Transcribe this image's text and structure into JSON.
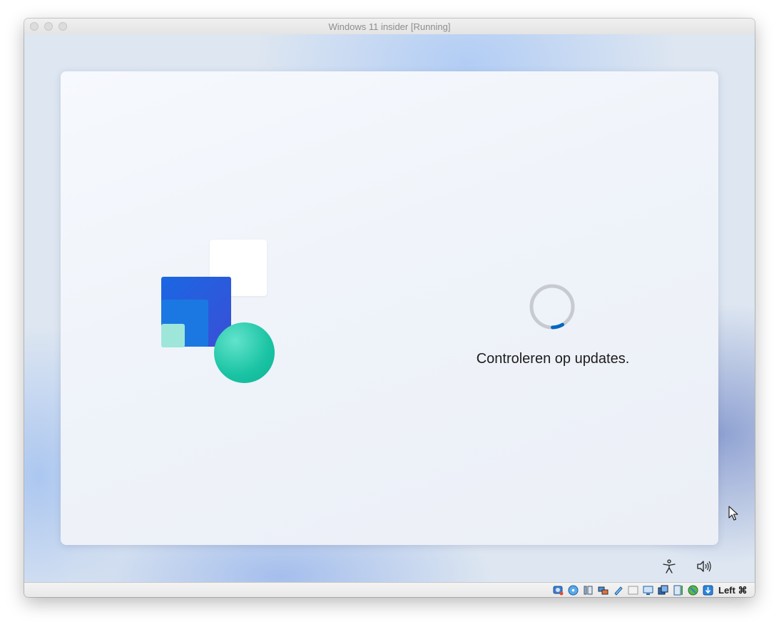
{
  "window": {
    "title": "Windows 11 insider [Running]",
    "traffic_lights": [
      "close",
      "minimize",
      "zoom"
    ]
  },
  "setup": {
    "status_text": "Controleren op updates.",
    "spinner_progress": 0.08,
    "accent": "#0067c0"
  },
  "bottom_icons": [
    "accessibility-icon",
    "volume-icon"
  ],
  "statusbar": {
    "icons": [
      "hard-disk-icon",
      "optical-drive-icon",
      "audio-icon",
      "network-icon",
      "usb-icon",
      "shared-folders-icon",
      "display-icon",
      "recording-icon",
      "cpu-icon",
      "guest-additions-icon",
      "mouse-integration-icon"
    ],
    "host_key": "Left ⌘"
  },
  "colors": {
    "logo_blue": "#1a67e3",
    "logo_teal": "#19c3a3",
    "logo_light_teal": "#9de6d9"
  }
}
